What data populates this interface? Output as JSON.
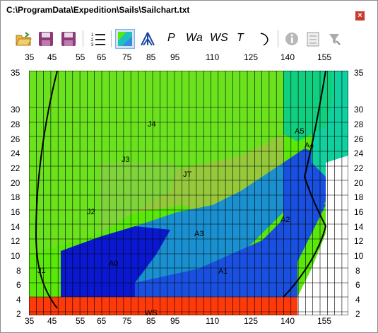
{
  "window": {
    "title": "C:\\ProgramData\\Expedition\\Sails\\Sailchart.txt",
    "close_glyph": "×"
  },
  "toolbar": {
    "text_tools": [
      "P",
      "Wa",
      "WS",
      "T"
    ]
  },
  "axes": {
    "top_ticks": [
      "35",
      "45",
      "55",
      "65",
      "75",
      "85",
      "95",
      "110",
      "125",
      "140",
      "155"
    ],
    "bottom_ticks": [
      "35",
      "45",
      "55",
      "65",
      "75",
      "85",
      "95",
      "110",
      "125",
      "140",
      "155"
    ],
    "left_ticks": [
      "35",
      "30",
      "28",
      "26",
      "24",
      "22",
      "20",
      "18",
      "16",
      "14",
      "12",
      "10",
      "8",
      "6",
      "4",
      "2"
    ],
    "right_ticks": [
      "35",
      "30",
      "28",
      "26",
      "24",
      "22",
      "20",
      "18",
      "16",
      "14",
      "12",
      "10",
      "8",
      "6",
      "4",
      "2"
    ]
  },
  "chart_data": {
    "type": "heatmap",
    "x_ticks": [
      35,
      45,
      55,
      65,
      75,
      85,
      95,
      110,
      125,
      140,
      155
    ],
    "y_ticks": [
      35,
      30,
      28,
      26,
      24,
      22,
      20,
      18,
      16,
      14,
      12,
      10,
      8,
      6,
      4,
      2
    ],
    "regions": [
      {
        "label": "J1",
        "color": "#5ae80a"
      },
      {
        "label": "J2",
        "color": "#5ae80a"
      },
      {
        "label": "J3",
        "color": "#7ed43a"
      },
      {
        "label": "J4",
        "color": "#6be21e"
      },
      {
        "label": "JT",
        "color": "#96c83c"
      },
      {
        "label": "A0",
        "color": "#0a18d0"
      },
      {
        "label": "A1",
        "color": "#1a50e0"
      },
      {
        "label": "A2",
        "color": "#1a50e0"
      },
      {
        "label": "A3",
        "color": "#1a90d0"
      },
      {
        "label": "A4",
        "color": "#10d0a0"
      },
      {
        "label": "A5",
        "color": "#10d080"
      },
      {
        "label": "WS",
        "color": "#ff3a0a"
      }
    ]
  }
}
